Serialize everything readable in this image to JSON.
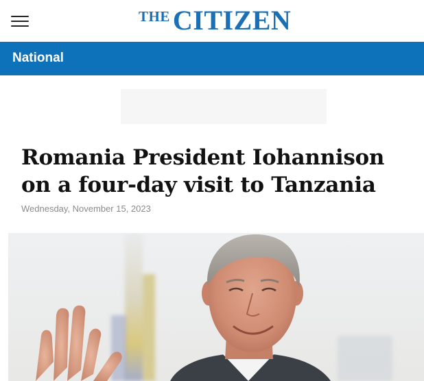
{
  "header": {
    "menu_icon": "hamburger-menu-icon",
    "logo_the": "THE",
    "logo_name": "CITIZEN",
    "brand_color": "#1a6fb5"
  },
  "section": {
    "label": "National",
    "bar_color": "#0d72b9"
  },
  "article": {
    "headline": "Romania President Iohannison on a four-day visit to Tanzania",
    "date": "Wednesday, November 15, 2023"
  }
}
